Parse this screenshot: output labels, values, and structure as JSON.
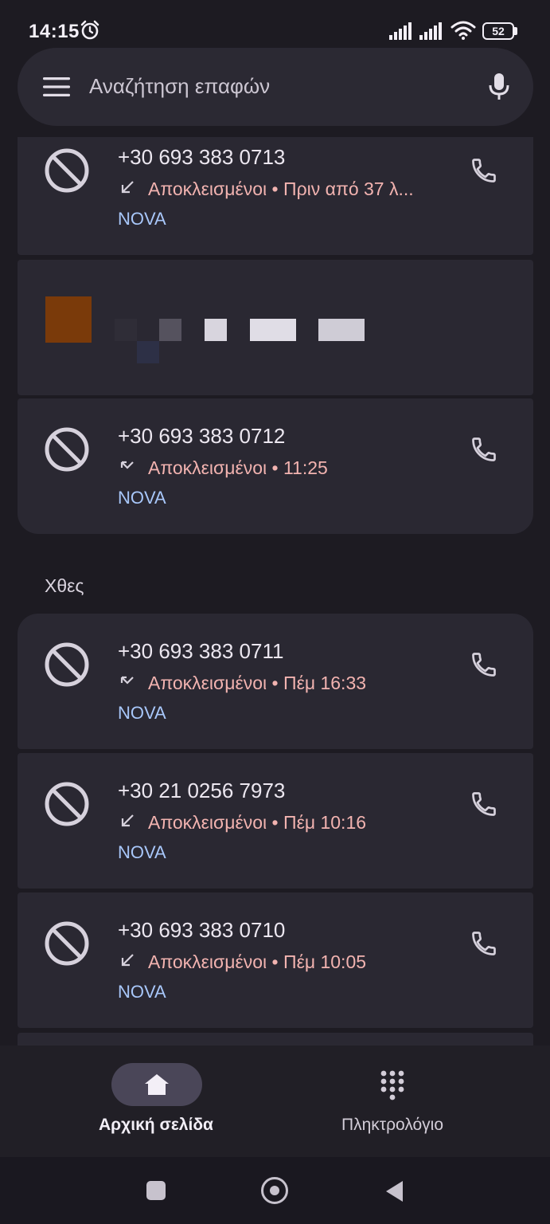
{
  "status_bar": {
    "time": "14:15",
    "battery": "52",
    "battery_fraction": 0.52
  },
  "search": {
    "placeholder": "Αναζήτηση επαφών",
    "icons": [
      "menu-icon",
      "mic-icon"
    ]
  },
  "calls": [
    {
      "number": "+30 693 383 0713",
      "direction": "incoming",
      "status": "Αποκλεισμένοι • Πριν από 37 λ...",
      "carrier": "NOVA"
    },
    {
      "number": "+30 693 383 0712",
      "direction": "missed",
      "status": "Αποκλεισμένοι • 11:25",
      "carrier": "NOVA"
    }
  ],
  "yesterday": {
    "header": "Χθες",
    "calls": [
      {
        "number": "+30 693 383 0711",
        "direction": "missed",
        "status": "Αποκλεισμένοι • Πέμ 16:33",
        "carrier": "NOVA"
      },
      {
        "number": "+30 21 0256 7973",
        "direction": "incoming",
        "status": "Αποκλεισμένοι • Πέμ 10:16",
        "carrier": "NOVA"
      },
      {
        "number": "+30 693 383 0710",
        "direction": "incoming",
        "status": "Αποκλεισμένοι • Πέμ 10:05",
        "carrier": "NOVA"
      }
    ]
  },
  "bottom_nav": {
    "home_label": "Αρχική σελίδα",
    "dialpad_label": "Πληκτρολόγιο"
  },
  "colors": {
    "background": "#1d1b22",
    "card": "#2a2832",
    "blocked_status": "#f2b3b0",
    "carrier": "#a8c7fa",
    "nav_pill": "#4a4658"
  }
}
